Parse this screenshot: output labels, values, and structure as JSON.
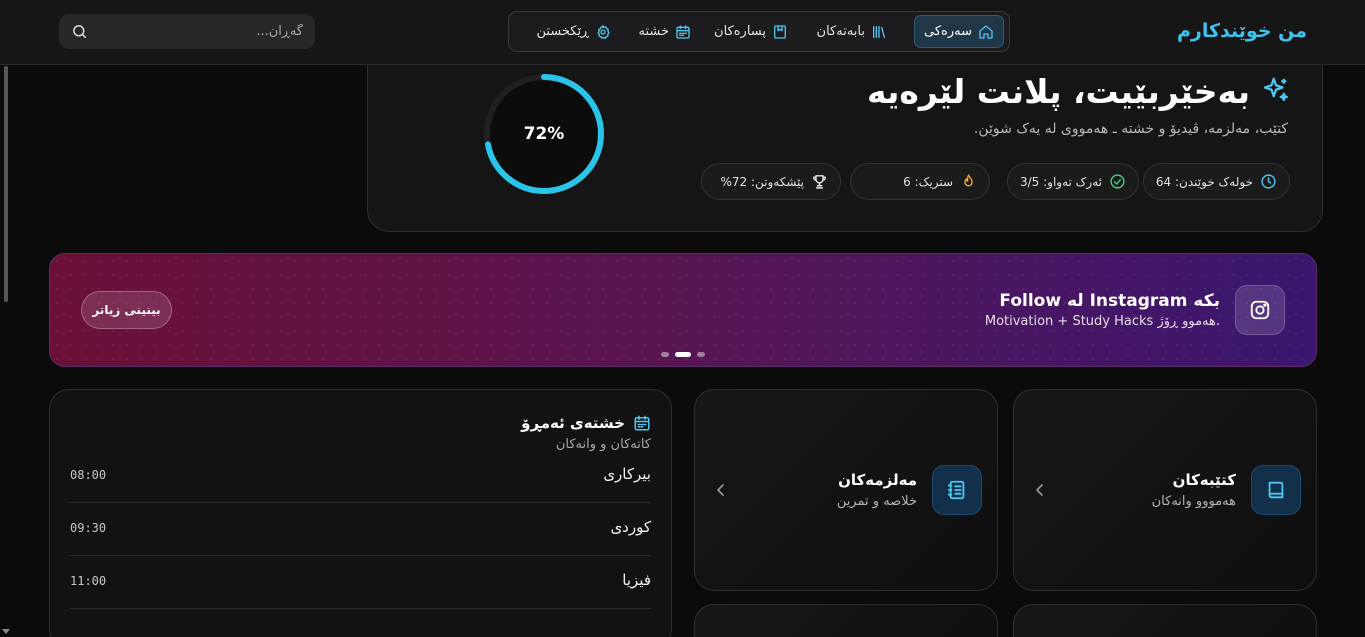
{
  "header": {
    "brand": "من خوێندکارم",
    "search_placeholder": "گەڕان...",
    "nav": [
      {
        "label": "سەرەکی",
        "icon": "home-icon",
        "active": true
      },
      {
        "label": "بابەتەکان",
        "icon": "library-icon"
      },
      {
        "label": "پسارەکان",
        "icon": "bookmark-icon"
      },
      {
        "label": "خشتە",
        "icon": "calendar-icon"
      },
      {
        "label": "ڕێکخستن",
        "icon": "gear-icon"
      }
    ]
  },
  "welcome": {
    "title": "بەخێربێیت، پلانت لێرەیە",
    "subtitle": "کتێب، مەلزمە، ڤیدیۆ و خشتە ـ هەمووی لە یەک شوێن.",
    "progress_label": "72%",
    "progress_value": 0.72,
    "stats": [
      {
        "label": "خولەک خوێندن: 64",
        "icon": "clock-icon"
      },
      {
        "label": "ئەرک تەواو: 3/5",
        "icon": "check-circle-icon"
      },
      {
        "label": "ستریک: 6",
        "icon": "flame-icon"
      },
      {
        "label": "پێشکەوتن: 72%",
        "icon": "trophy-icon"
      }
    ]
  },
  "banner": {
    "title": "Follow لە Instagram بکە",
    "subtitle": "Motivation + Study Hacks هەموو ڕۆژ.",
    "button": "بینینی زیاتر",
    "icon": "instagram-icon",
    "slide_index": 1,
    "slide_count": 3
  },
  "schedule": {
    "title": "خشتەی ئەمڕۆ",
    "subtitle": "کاتەکان و وانەکان",
    "rows": [
      {
        "time": "08:00",
        "subject": "بیرکاری"
      },
      {
        "time": "09:30",
        "subject": "کوردی"
      },
      {
        "time": "11:00",
        "subject": "فیزیا"
      }
    ]
  },
  "cards": [
    {
      "title": "کتێبەکان",
      "subtitle": "هەمووو وانەکان",
      "icon": "book-icon"
    },
    {
      "title": "مەلزمەکان",
      "subtitle": "خلاصە و تمرین",
      "icon": "notebook-icon"
    }
  ],
  "colors": {
    "accent": "#3ec3f0",
    "ring": "#29c4e8",
    "banner_start": "#6b1036",
    "banner_end": "#3b1770"
  }
}
